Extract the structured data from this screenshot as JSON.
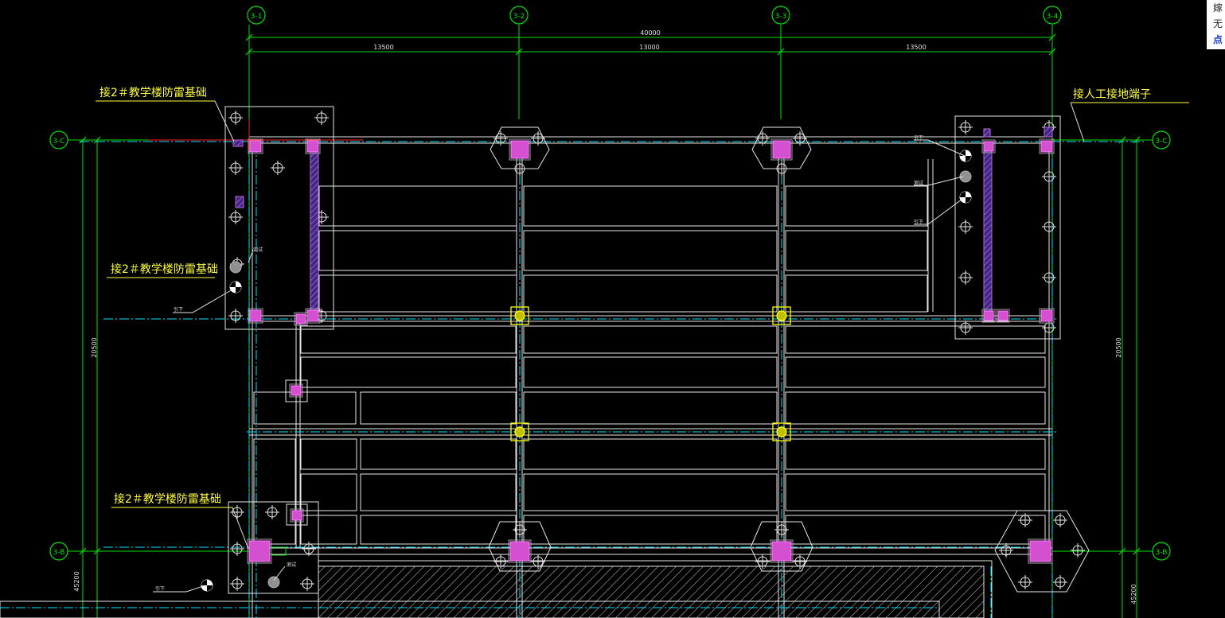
{
  "colors": {
    "background": "#000000",
    "axis": "#00e000",
    "grid_dash": "#00e6ff",
    "member": "#e6e6e6",
    "column": "#d450d0",
    "column_edge": "#a0a0a0",
    "callout": "#ffff40",
    "highlight": "#ffff00",
    "hatch": "#b040d0"
  },
  "axes": {
    "top": [
      "3-1",
      "3-2",
      "3-3",
      "3-4"
    ],
    "left": [
      "3-C",
      "3-B"
    ],
    "right": [
      "3-C",
      "3-B"
    ]
  },
  "dimensions": {
    "overall": "40000",
    "spans": [
      "13500",
      "13000",
      "13500"
    ],
    "vertical_left": "20500",
    "vertical_right": "20500",
    "lower_left": "45200",
    "lower_right": "45200"
  },
  "callouts": {
    "top_left": "接2＃教学楼防雷基础",
    "mid_left": "接2＃教学楼防雷基础",
    "bottom_left": "接2＃教学楼防雷基础",
    "top_right": "接人工接地端子"
  },
  "small_labels": {
    "a": "测试",
    "b": "引下",
    "c": "测试",
    "d": "引下",
    "e": "测试",
    "f": "测试",
    "g": "引下"
  },
  "side_panel": {
    "line1": "嫁",
    "line2": "无",
    "line3": "点"
  }
}
